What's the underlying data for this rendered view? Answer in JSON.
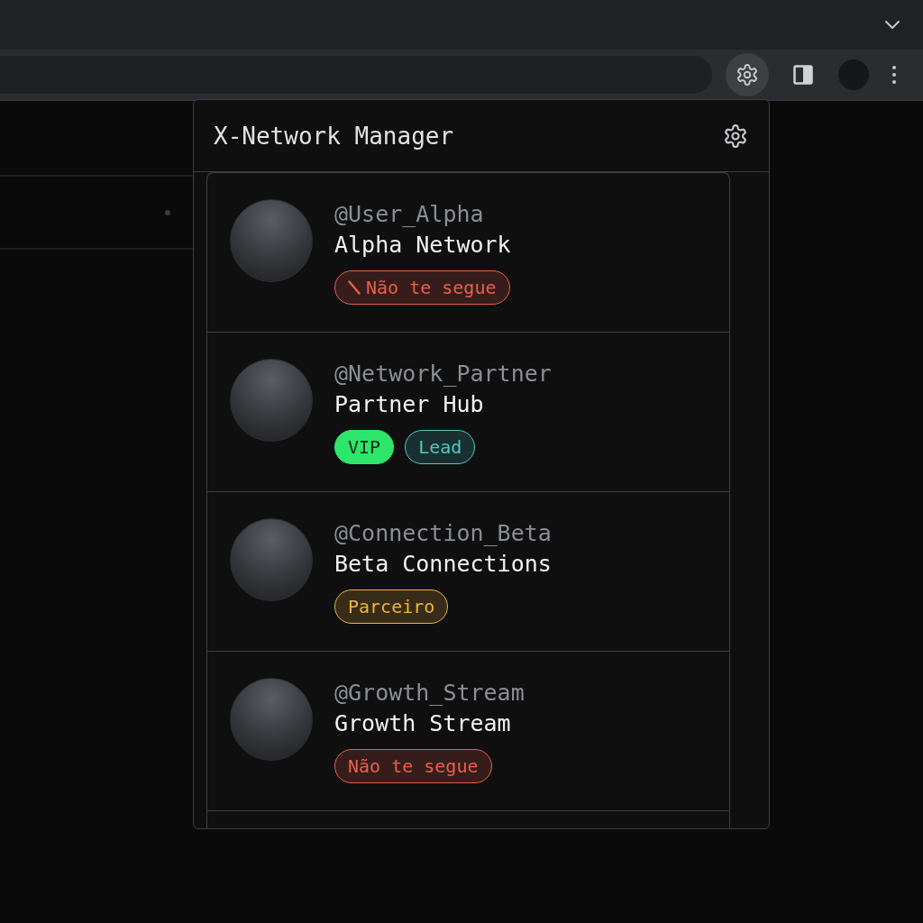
{
  "popup": {
    "title": "X-Network Manager"
  },
  "accounts": [
    {
      "handle": "@User_Alpha",
      "name": "Alpha Network",
      "tags": [
        {
          "label": "Não te segue",
          "kind": "outline",
          "color": "#e8604c",
          "icon": true
        }
      ]
    },
    {
      "handle": "@Network_Partner",
      "name": "Partner Hub",
      "tags": [
        {
          "label": "VIP",
          "kind": "solid",
          "color": "#2ee66b",
          "icon": false
        },
        {
          "label": "Lead",
          "kind": "outline",
          "color": "#4fc9c0",
          "icon": false
        }
      ]
    },
    {
      "handle": "@Connection_Beta",
      "name": "Beta Connections",
      "tags": [
        {
          "label": "Parceiro",
          "kind": "outline",
          "color": "#f0b43c",
          "icon": false
        }
      ]
    },
    {
      "handle": "@Growth_Stream",
      "name": "Growth Stream",
      "tags": [
        {
          "label": "Não te segue",
          "kind": "outline",
          "color": "#e8604c",
          "icon": false
        }
      ]
    }
  ]
}
